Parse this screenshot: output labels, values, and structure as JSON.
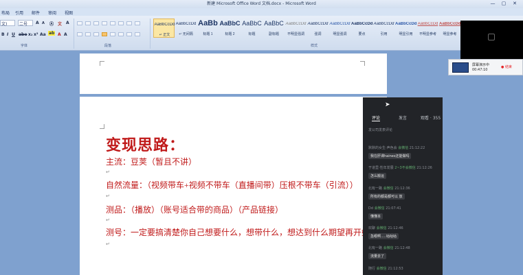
{
  "window": {
    "title": "新建 Microsoft Office Word 文档.docx - Microsoft Word",
    "controls": [
      "—",
      "▢",
      "✕"
    ]
  },
  "ribbon_tabs": [
    "布局",
    "引用",
    "邮件",
    "审阅",
    "视图"
  ],
  "ribbon": {
    "font_name": "文)",
    "font_size": "二号",
    "group_font": "字体",
    "group_paragraph": "段落",
    "group_styles": "样式",
    "styles": [
      {
        "sample": "AaBbCcDd",
        "name": "↵ 正文"
      },
      {
        "sample": "AaBbCcDd",
        "name": "↵ 无间隔"
      },
      {
        "sample": "AaBb",
        "name": "标题 1"
      },
      {
        "sample": "AaBbC",
        "name": "标题 2"
      },
      {
        "sample": "AaBbC",
        "name": "标题"
      },
      {
        "sample": "AaBbC",
        "name": "副标题"
      },
      {
        "sample": "AaBbCcDd",
        "name": "不明显强调"
      },
      {
        "sample": "AaBbCcDd",
        "name": "强调"
      },
      {
        "sample": "AaBbCcDd",
        "name": "明显强调"
      },
      {
        "sample": "AaBbCcDd",
        "name": "要点"
      },
      {
        "sample": "AaBbCcDd",
        "name": "引用"
      },
      {
        "sample": "AaBbCcDd",
        "name": "明显引用"
      },
      {
        "sample": "AaBbCcDd",
        "name": "不明显参考"
      },
      {
        "sample": "AaBbCcDd",
        "name": "明显参考"
      }
    ]
  },
  "document": {
    "heading": "变现思路：",
    "lines": [
      "主流：豆荚（暂且不讲）",
      "自然流量：（视频带车+视频不带车（直播间带）压根不带车（引流））",
      "测品：（播放）（账号适合带的商品）（产品链接）",
      "测号：一定要搞清楚你自己想要什么，想带什么，想达到什么期望再开始。"
    ],
    "paragraph_mark": "↵"
  },
  "comment_panel": {
    "tabs": [
      "评论",
      "发言",
      "观看 · 355"
    ],
    "hint": "发公司发表评论",
    "comments": [
      {
        "name": "默默的女生·声色会",
        "tag": "会微信",
        "time": "21:12:22",
        "text": "我在肝课haines还能做吗"
      },
      {
        "name": "于道里·性年发展",
        "tag": "2~3不会微信",
        "time": "21:12:26",
        "text": "怎么搬运"
      },
      {
        "name": "北有一路",
        "tag": "会微信",
        "time": "21:12:36",
        "text": "所有的都是都可以 放"
      },
      {
        "name": "Dd",
        "tag": "会微信",
        "time": "21:07:41",
        "text": "懂懂本"
      },
      {
        "name": "欢聊",
        "tag": "会微信",
        "time": "21:12:46",
        "text": "急眼啊.....咕咕咕"
      },
      {
        "name": "北有一路",
        "tag": "会微信",
        "time": "21:12:48",
        "text": "流量去了"
      },
      {
        "name": "随行",
        "tag": "会微信",
        "time": "21:12:53",
        "text": ""
      }
    ]
  },
  "recorder": {
    "label": "屏幕演示中",
    "time": "00:47:10",
    "stop_label": "结束",
    "colors": {
      "stop": "#e5262a"
    }
  }
}
